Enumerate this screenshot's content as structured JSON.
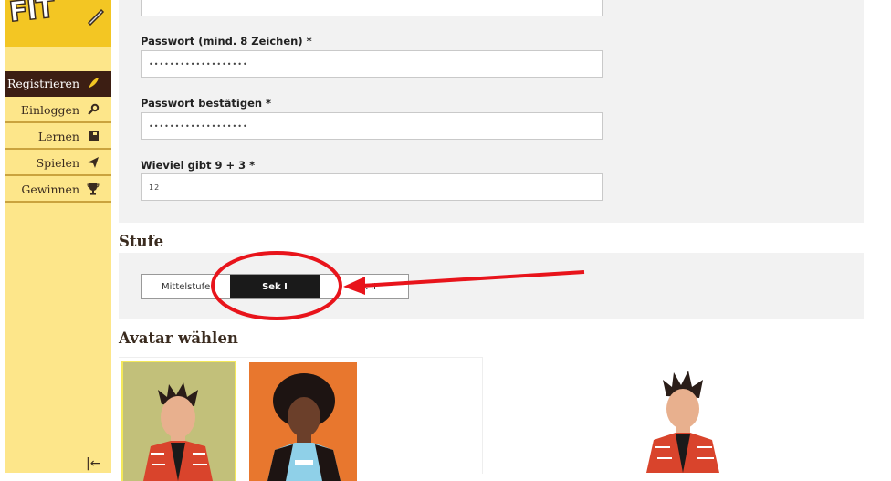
{
  "sidebar": {
    "logo_text": "FIT",
    "items": [
      {
        "label": "Registrieren",
        "icon": "feather-icon",
        "active": true
      },
      {
        "label": "Einloggen",
        "icon": "key-icon",
        "active": false
      },
      {
        "label": "Lernen",
        "icon": "book-icon",
        "active": false
      },
      {
        "label": "Spielen",
        "icon": "paper-plane-icon",
        "active": false
      },
      {
        "label": "Gewinnen",
        "icon": "trophy-icon",
        "active": false
      }
    ],
    "collapse_glyph": "|←"
  },
  "form": {
    "password_label": "Passwort (mind. 8 Zeichen) *",
    "password_value": "•••••••••••••••••••",
    "confirm_label": "Passwort bestätigen *",
    "confirm_value": "•••••••••••••••••••",
    "captcha_label": "Wieviel gibt 9 + 3 *",
    "captcha_value": "12"
  },
  "level": {
    "heading": "Stufe",
    "options": [
      "Mittelstufe",
      "Sek I",
      "Sek II"
    ],
    "selected": "Sek I"
  },
  "avatar": {
    "heading": "Avatar wählen"
  },
  "colors": {
    "sidebar_bg": "#fde68a",
    "active_nav": "#3c1e13",
    "annotation": "#e8141b"
  }
}
